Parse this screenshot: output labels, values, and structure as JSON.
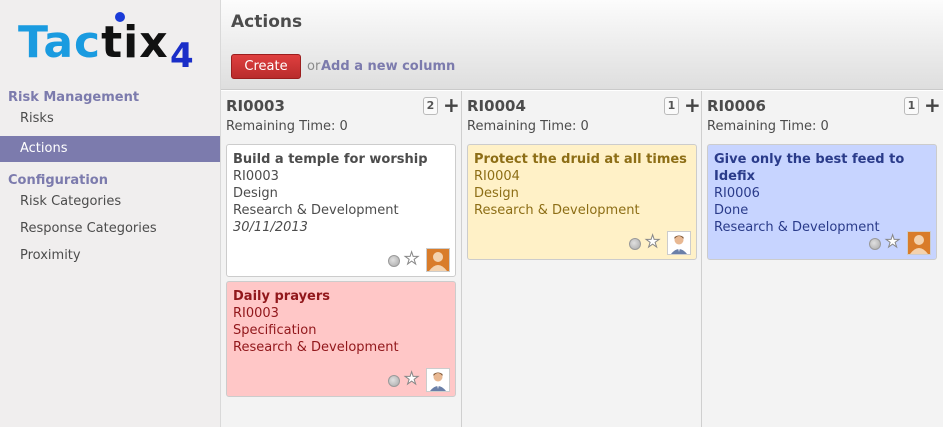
{
  "logo": {
    "text_a": "Tac",
    "text_b": "tix",
    "text_c": "4"
  },
  "sidebar": {
    "sections": [
      {
        "label": "Risk Management",
        "items": [
          {
            "label": "Risks",
            "active": false
          },
          {
            "label": "Actions",
            "active": true
          }
        ]
      },
      {
        "label": "Configuration",
        "items": [
          {
            "label": "Risk Categories"
          },
          {
            "label": "Response Categories"
          },
          {
            "label": "Proximity"
          }
        ]
      }
    ]
  },
  "header": {
    "title": "Actions",
    "create_label": "Create",
    "or_label": "or",
    "add_column_label": "Add a new column"
  },
  "columns": [
    {
      "title": "RI0003",
      "count": "2",
      "add_label": "+",
      "remaining": "Remaining Time: 0",
      "cards": [
        {
          "title": "Build a temple for worship",
          "ref": "RI0003",
          "stage": "Design",
          "department": "Research & Development",
          "date": "30/11/2013",
          "color": "#ffffff",
          "title_color": "#4c4c4c",
          "text_color": "#4c4c4c",
          "avatar": "placeholder"
        },
        {
          "title": "Daily prayers",
          "ref": "RI0003",
          "stage": "Specification",
          "department": "Research & Development",
          "color": "#ffc7c7",
          "title_color": "#91171b",
          "text_color": "#91171b",
          "avatar": "photo"
        }
      ]
    },
    {
      "title": "RI0004",
      "count": "1",
      "add_label": "+",
      "remaining": "Remaining Time: 0",
      "cards": [
        {
          "title": "Protect the druid at all times",
          "ref": "RI0004",
          "stage": "Design",
          "department": "Research & Development",
          "color": "#fff1c7",
          "title_color": "#8d6e16",
          "text_color": "#8d6e16",
          "avatar": "photo"
        }
      ]
    },
    {
      "title": "RI0006",
      "count": "1",
      "add_label": "+",
      "remaining": "Remaining Time: 0",
      "cards": [
        {
          "title": "Give only the best feed to Idefix",
          "ref": "RI0006",
          "stage": "Done",
          "department": "Research & Development",
          "color": "#c7d4ff",
          "title_color": "#2a3b8a",
          "text_color": "#2a3b8a",
          "avatar": "placeholder"
        }
      ]
    }
  ],
  "icons": {
    "priority": "priority-dot-icon",
    "favorite": "star-icon",
    "assignee": "avatar-icon"
  }
}
